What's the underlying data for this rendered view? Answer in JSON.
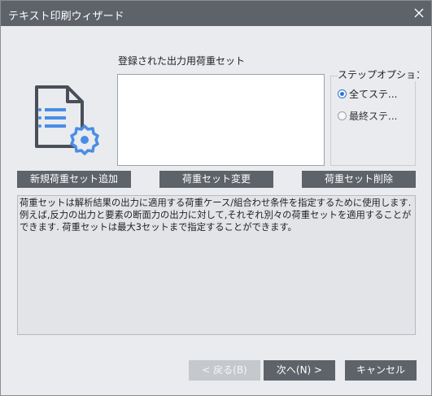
{
  "window": {
    "title": "テキスト印刷ウィザード",
    "close_icon": "close-icon"
  },
  "list": {
    "label": "登録された出力用荷重セット",
    "items": []
  },
  "step_options": {
    "legend": "ステップオプション",
    "options": [
      {
        "label": "全てステ...",
        "checked": true
      },
      {
        "label": "最終ステ...",
        "checked": false
      }
    ]
  },
  "buttons": {
    "add": "新規荷重セット追加",
    "modify": "荷重セット変更",
    "delete": "荷重セット削除"
  },
  "description": "荷重セットは解析結果の出力に適用する荷重ケース/組合わせ条件を指定するために使用します.例えば,反力の出力と要素の断面力の出力に対して,それぞれ別々の荷重セットを適用することができます. 荷重セットは最大3セットまで指定することができます。",
  "footer": {
    "back": "< 戻る(B)",
    "next": "次へ(N) >",
    "cancel": "キャンセル"
  },
  "colors": {
    "titlebar": "#5e636a",
    "button": "#5e636a",
    "icon_dark": "#4a4f57",
    "icon_accent": "#4a8de8",
    "radio_accent": "#2f74d0"
  }
}
